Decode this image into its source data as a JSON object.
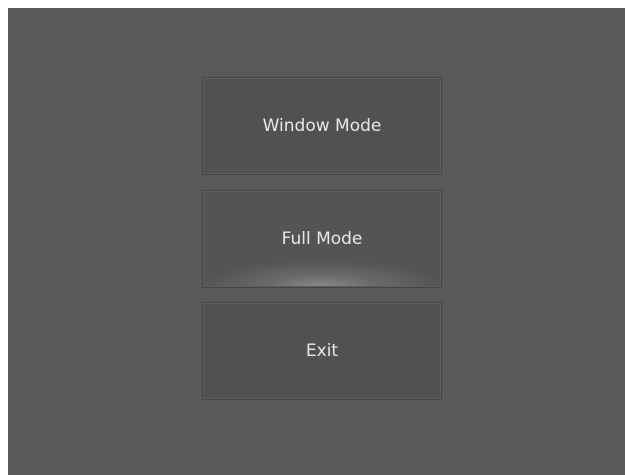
{
  "menu": {
    "window_mode_label": "Window Mode",
    "full_mode_label": "Full Mode",
    "exit_label": "Exit"
  },
  "colors": {
    "panel_background": "#595959",
    "button_background": "#515151",
    "button_border": "#454545",
    "text": "#e8e8e8",
    "hover_glow": "#8a8a8a"
  },
  "state": {
    "hovered_button": "Full Mode"
  }
}
